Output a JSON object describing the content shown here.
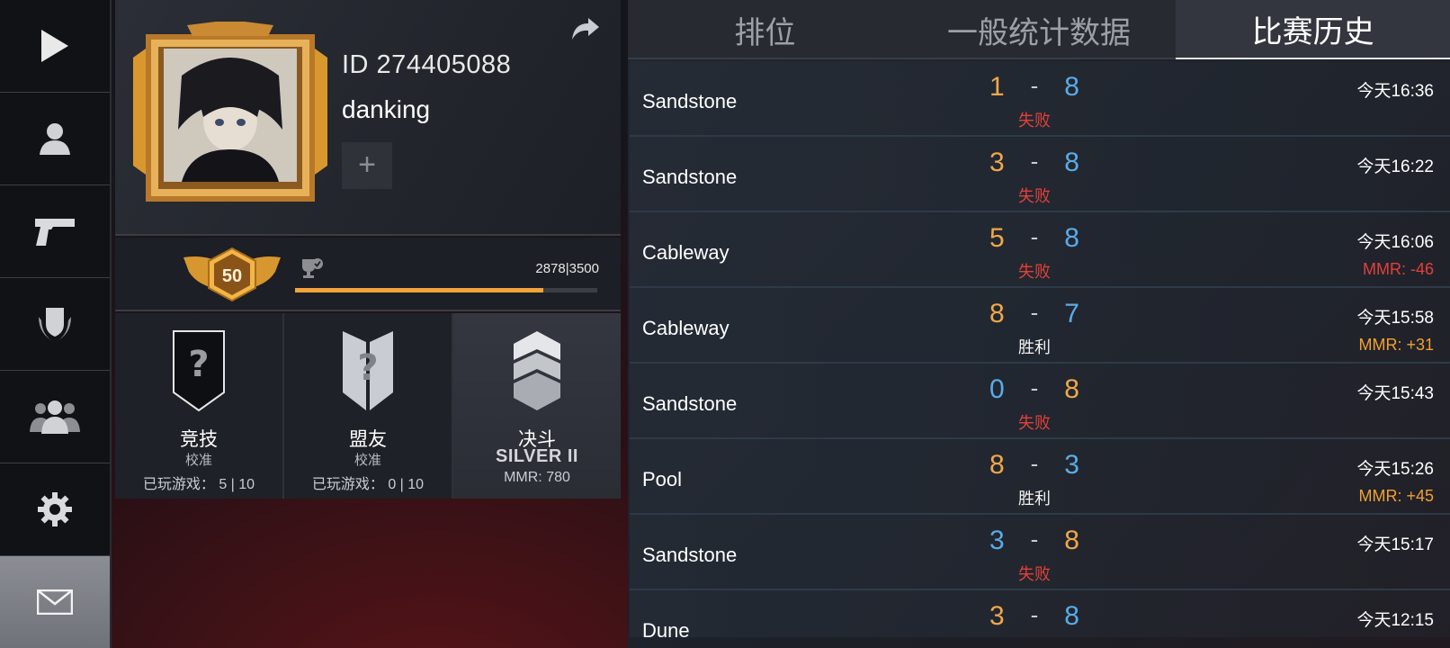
{
  "nav": {
    "items": [
      {
        "icon": "play-icon"
      },
      {
        "icon": "profile-icon"
      },
      {
        "icon": "pistol-icon"
      },
      {
        "icon": "clan-emblem-icon"
      },
      {
        "icon": "friends-icon"
      },
      {
        "icon": "gear-icon"
      },
      {
        "icon": "mail-icon",
        "active": true
      }
    ]
  },
  "profile": {
    "id_text": "ID 274405088",
    "name": "danking",
    "add_label": "+",
    "level": "50",
    "xp_text": "2878|3500",
    "xp_progress": 0.822
  },
  "modes": [
    {
      "title": "竞技",
      "sub": "校准",
      "games": "已玩游戏： 5 | 10"
    },
    {
      "title": "盟友",
      "sub": "校准",
      "games": "已玩游戏： 0 | 10"
    },
    {
      "title": "决斗",
      "rank": "SILVER II",
      "mmr": "MMR: 780"
    }
  ],
  "tabs": [
    {
      "label": "排位",
      "active": false
    },
    {
      "label": "一般统计数据",
      "active": false
    },
    {
      "label": "比赛历史",
      "active": true
    }
  ],
  "matches": [
    {
      "map": "Sandstone",
      "left": "1",
      "right": "8",
      "left_color": "#f0a84a",
      "right_color": "#5aabe8",
      "result": "失败",
      "time": "今天16:36",
      "mmr": ""
    },
    {
      "map": "Sandstone",
      "left": "3",
      "right": "8",
      "left_color": "#f0a84a",
      "right_color": "#5aabe8",
      "result": "失败",
      "time": "今天16:22",
      "mmr": ""
    },
    {
      "map": "Cableway",
      "left": "5",
      "right": "8",
      "left_color": "#f0a84a",
      "right_color": "#5aabe8",
      "result": "失败",
      "time": "今天16:06",
      "mmr": "MMR: -46"
    },
    {
      "map": "Cableway",
      "left": "8",
      "right": "7",
      "left_color": "#f0a84a",
      "right_color": "#5aabe8",
      "result": "胜利",
      "time": "今天15:58",
      "mmr": "MMR: +31"
    },
    {
      "map": "Sandstone",
      "left": "0",
      "right": "8",
      "left_color": "#5aabe8",
      "right_color": "#f0a84a",
      "result": "失败",
      "time": "今天15:43",
      "mmr": ""
    },
    {
      "map": "Pool",
      "left": "8",
      "right": "3",
      "left_color": "#f0a84a",
      "right_color": "#5aabe8",
      "result": "胜利",
      "time": "今天15:26",
      "mmr": "MMR: +45"
    },
    {
      "map": "Sandstone",
      "left": "3",
      "right": "8",
      "left_color": "#5aabe8",
      "right_color": "#f0a84a",
      "result": "失败",
      "time": "今天15:17",
      "mmr": ""
    },
    {
      "map": "Dune",
      "left": "3",
      "right": "8",
      "left_color": "#f0a84a",
      "right_color": "#5aabe8",
      "result": "",
      "time": "今天12:15",
      "mmr": ""
    }
  ],
  "colors": {
    "loss": "#e2403a",
    "win": "#f2f2f2",
    "mmr_loss": "#e2403a",
    "mmr_gain": "#f0a030",
    "accent": "#f2a33a"
  }
}
